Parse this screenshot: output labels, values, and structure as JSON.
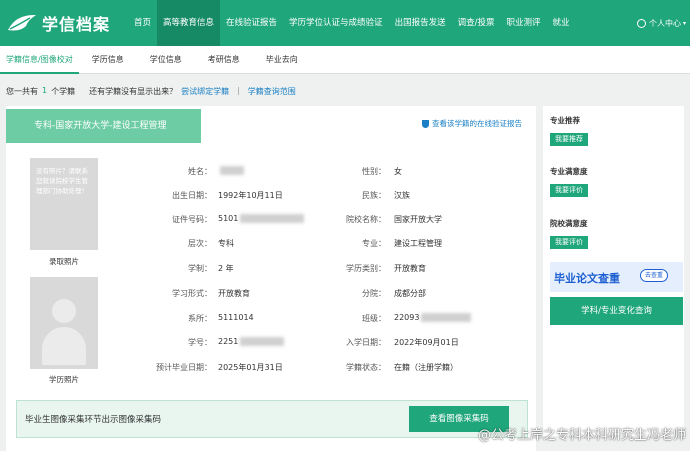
{
  "brand": {
    "name": "学信档案"
  },
  "nav": {
    "items": [
      "首页",
      "高等教育信息",
      "在线验证报告",
      "学历学位认证与成绩验证",
      "出国报告发送",
      "调查/投票",
      "职业测评",
      "就业"
    ],
    "active_index": 1,
    "user_label": "个人中心"
  },
  "subnav": {
    "items": [
      "学籍信息/图像校对",
      "学历信息",
      "学位信息",
      "考研信息",
      "毕业去向"
    ],
    "active_index": 0
  },
  "infoline": {
    "prefix": "您一共有",
    "count": "1",
    "unit": "个学籍",
    "question": "还有学籍没有显示出来？",
    "bind_link": "尝试绑定学籍",
    "sep": "|",
    "scope_link": "学籍查询范围"
  },
  "record": {
    "banner": "专科-国家开放大学-建设工程管理",
    "verify_link": "查看该学籍的在线验证报告",
    "photo_admission": {
      "placeholder": "没有照片？请联系您就读院校学生管理部门协助处理！",
      "caption": "录取照片"
    },
    "photo_degree": {
      "caption": "学历照片"
    },
    "fields": {
      "name": {
        "label": "姓名：",
        "value": ""
      },
      "gender": {
        "label": "性别：",
        "value": "女"
      },
      "birth": {
        "label": "出生日期：",
        "value": "1992年10月11日"
      },
      "ethnicity": {
        "label": "民族：",
        "value": "汉族"
      },
      "id_no": {
        "label": "证件号码：",
        "value": "5101"
      },
      "school": {
        "label": "院校名称：",
        "value": "国家开放大学"
      },
      "level": {
        "label": "层次：",
        "value": "专科"
      },
      "major": {
        "label": "专业：",
        "value": "建设工程管理"
      },
      "duration": {
        "label": "学制：",
        "value": "2 年"
      },
      "edu_type": {
        "label": "学历类别：",
        "value": "开放教育"
      },
      "study_form": {
        "label": "学习形式：",
        "value": "开放教育"
      },
      "branch": {
        "label": "分院：",
        "value": "成都分部"
      },
      "department": {
        "label": "系所：",
        "value": "5111014"
      },
      "class": {
        "label": "班级：",
        "value": "22093"
      },
      "student_no": {
        "label": "学号：",
        "value": "2251"
      },
      "enroll_date": {
        "label": "入学日期：",
        "value": "2022年09月01日"
      },
      "grad_date": {
        "label": "预计毕业日期：",
        "value": "2025年01月31日"
      },
      "status": {
        "label": "学籍状态：",
        "value": "在籍（注册学籍）"
      }
    },
    "bottom": {
      "text": "毕业生图像采集环节出示图像采集码",
      "button": "查看图像采集码"
    }
  },
  "side": {
    "major_rec": {
      "title": "专业推荐",
      "button": "我要推荐"
    },
    "major_sat": {
      "title": "专业满意度",
      "button": "我要评价"
    },
    "school_sat": {
      "title": "院校满意度",
      "button": "我要评价"
    },
    "ad": {
      "text": "毕业论文查重",
      "button": "去查重"
    },
    "query_button": "学科/专业变化查询"
  },
  "watermark": {
    "text": "@公考上岸之专科本科研究生冯老师"
  },
  "colors": {
    "primary": "#1fa67a",
    "banner": "#6dcca4",
    "link": "#1a7fc4"
  }
}
